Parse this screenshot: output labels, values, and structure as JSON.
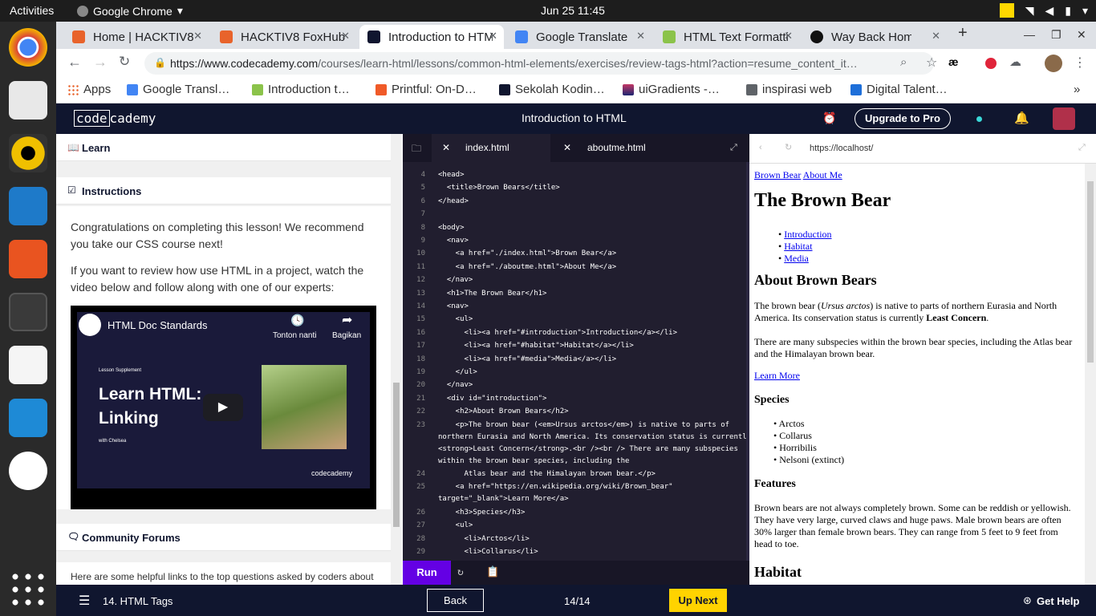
{
  "os": {
    "activities": "Activities",
    "app_name": "Google Chrome",
    "clock": "Jun 25  11:45"
  },
  "dock": [
    {
      "name": "chrome-icon",
      "color": "#4285f4"
    },
    {
      "name": "files-icon",
      "color": "#e0e0e0"
    },
    {
      "name": "rhythmbox-icon",
      "color": "#f0c000"
    },
    {
      "name": "writer-icon",
      "color": "#1e7ac9"
    },
    {
      "name": "software-icon",
      "color": "#e95420"
    },
    {
      "name": "terminal-icon",
      "color": "#444"
    },
    {
      "name": "text-editor-icon",
      "color": "#f5f5f5"
    },
    {
      "name": "vscode-icon",
      "color": "#1e8ad6"
    },
    {
      "name": "slack-icon",
      "color": "#fff"
    },
    {
      "name": "app-grid-icon",
      "color": "#2a2a2a"
    }
  ],
  "tabs": [
    {
      "title": "Home | HACKTIV8",
      "fav": "#e8632b"
    },
    {
      "title": "HACKTIV8 FoxHub",
      "fav": "#e8632b"
    },
    {
      "title": "Introduction to HTML",
      "fav": "#10162f"
    },
    {
      "title": "Google Translate",
      "fav": "#4285f4"
    },
    {
      "title": "HTML Text Formatting",
      "fav": "#8bc34a"
    },
    {
      "title": "Way Back Home",
      "fav": "#1db954"
    }
  ],
  "address": {
    "host": "https://www.codecademy.com",
    "path": "/courses/learn-html/lessons/common-html-elements/exercises/review-tags-html?action=resume_content_it…"
  },
  "bookmarks": [
    "Apps",
    "Google Transl…",
    "Introduction t…",
    "Printful: On-D…",
    "Sekolah Kodin…",
    "uiGradients -…",
    "inspirasi web",
    "Digital Talent…"
  ],
  "header": {
    "logo": "code",
    "logo2": "cademy",
    "title": "Introduction to HTML",
    "pro": "Upgrade to Pro"
  },
  "left": {
    "learn": "Learn",
    "instructions": "Instructions",
    "p1": "Congratulations on completing this lesson! We recommend you take our CSS course next!",
    "p2": "If you want to review how use HTML in a project, watch the video below and follow along with one of our experts:",
    "video_title": "HTML Doc Standards",
    "watch_later": "Tonton nanti",
    "share": "Bagikan",
    "supplement": "Lesson Supplement",
    "video_big": "Learn HTML: Linking",
    "with": "with Chelsea",
    "brand": "codecademy",
    "forums": "Community Forums",
    "forums_text": "Here are some helpful links to the top questions asked by coders about"
  },
  "editor": {
    "tab1": "index.html",
    "tab2": "aboutme.html",
    "run": "Run"
  },
  "code": [
    {
      "n": "4",
      "t": "<head>"
    },
    {
      "n": "5",
      "t": "  <title>Brown Bears</title>"
    },
    {
      "n": "6",
      "t": "</head>"
    },
    {
      "n": "7",
      "t": ""
    },
    {
      "n": "8",
      "t": "<body>"
    },
    {
      "n": "9",
      "t": "  <nav>"
    },
    {
      "n": "10",
      "t": "    <a href=\"./index.html\">Brown Bear</a>"
    },
    {
      "n": "11",
      "t": "    <a href=\"./aboutme.html\">About Me</a>"
    },
    {
      "n": "12",
      "t": "  </nav>"
    },
    {
      "n": "13",
      "t": "  <h1>The Brown Bear</h1>"
    },
    {
      "n": "14",
      "t": "  <nav>"
    },
    {
      "n": "15",
      "t": "    <ul>"
    },
    {
      "n": "16",
      "t": "      <li><a href=\"#introduction\">Introduction</a></li>"
    },
    {
      "n": "17",
      "t": "      <li><a href=\"#habitat\">Habitat</a></li>"
    },
    {
      "n": "18",
      "t": "      <li><a href=\"#media\">Media</a></li>"
    },
    {
      "n": "19",
      "t": "    </ul>"
    },
    {
      "n": "20",
      "t": "  </nav>"
    },
    {
      "n": "21",
      "t": "  <div id=\"introduction\">"
    },
    {
      "n": "22",
      "t": "    <h2>About Brown Bears</h2>"
    },
    {
      "n": "23",
      "t": "    <p>The brown bear (<em>Ursus arctos</em>) is native to parts of"
    },
    {
      "n": "",
      "t": "northern Eurasia and North America. Its conservation status is currently"
    },
    {
      "n": "",
      "t": "<strong>Least Concern</strong>.<br /><br /> There are many subspecies"
    },
    {
      "n": "",
      "t": "within the brown bear species, including the"
    },
    {
      "n": "24",
      "t": "      Atlas bear and the Himalayan brown bear.</p>"
    },
    {
      "n": "25",
      "t": "    <a href=\"https://en.wikipedia.org/wiki/Brown_bear\""
    },
    {
      "n": "",
      "t": "target=\"_blank\">Learn More</a>"
    },
    {
      "n": "26",
      "t": "    <h3>Species</h3>"
    },
    {
      "n": "27",
      "t": "    <ul>"
    },
    {
      "n": "28",
      "t": "      <li>Arctos</li>"
    },
    {
      "n": "29",
      "t": "      <li>Collarus</li>"
    }
  ],
  "preview": {
    "url": "https://localhost/",
    "nav1": "Brown Bear",
    "nav2": "About Me",
    "h1": "The Brown Bear",
    "links": [
      "Introduction",
      "Habitat",
      "Media"
    ],
    "h2": "About Brown Bears",
    "p1a": "The brown bear (",
    "p1em": "Ursus arctos",
    "p1b": ") is native to parts of northern Eurasia and North America. Its conservation status is currently ",
    "p1strong": "Least Concern",
    "p1c": ".",
    "p2": "There are many subspecies within the brown bear species, including the Atlas bear and the Himalayan brown bear.",
    "learn_more": "Learn More",
    "h3a": "Species",
    "species": [
      "Arctos",
      "Collarus",
      "Horribilis",
      "Nelsoni (extinct)"
    ],
    "h3b": "Features",
    "features": "Brown bears are not always completely brown. Some can be reddish or yellowish. They have very large, curved claws and huge paws. Male brown bears are often 30% larger than female brown bears. They can range from 5 feet to 9 feet from head to toe.",
    "h2b": "Habitat"
  },
  "footer": {
    "lesson": "14. HTML Tags",
    "back": "Back",
    "progress": "14/14",
    "next": "Up Next",
    "help": "Get Help"
  }
}
